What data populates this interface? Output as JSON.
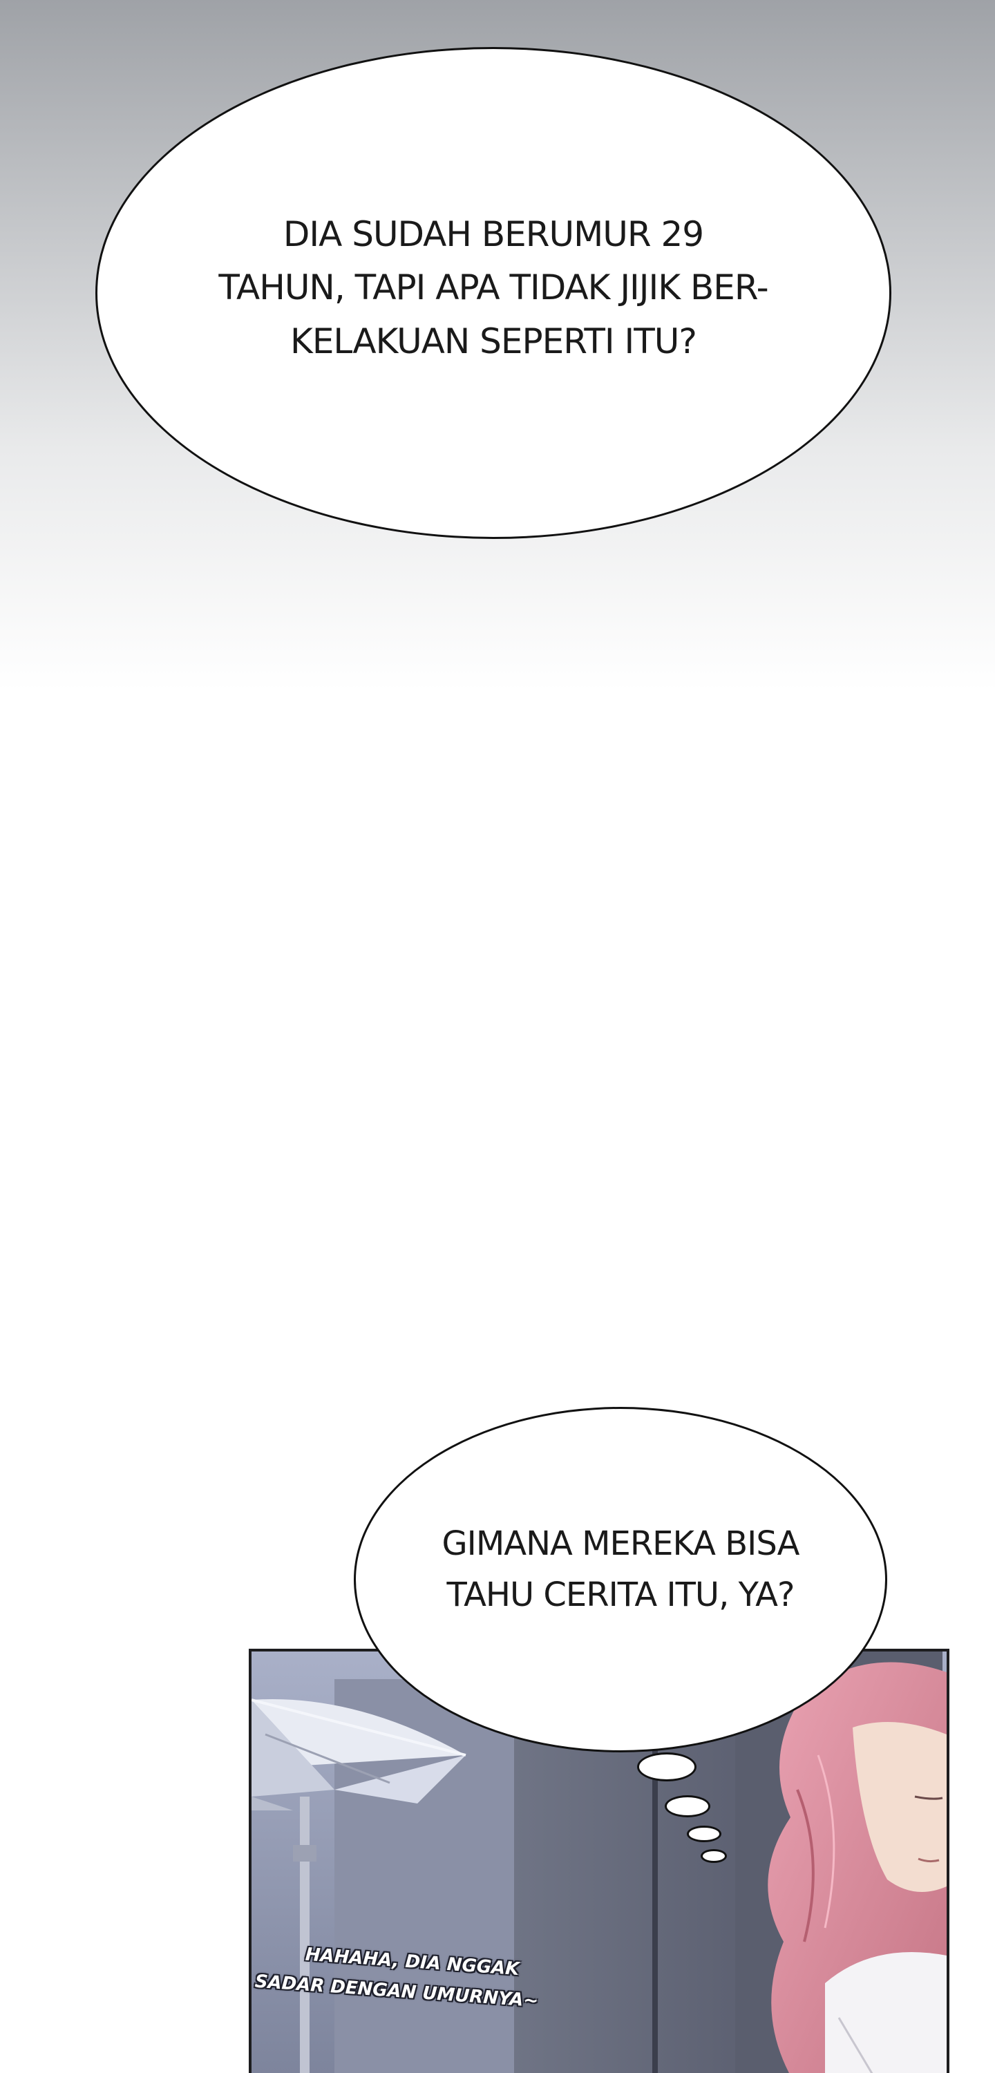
{
  "bubbles": [
    {
      "lines": [
        "DIA SUDAH BERUMUR 29",
        "TAHUN, TAPI APA TIDAK JIJIK BER-",
        "KELAKUAN SEPERTI ITU?"
      ]
    },
    {
      "lines": [
        "GIMANA MEREKA BISA",
        "TAHU CERITA ITU, YA?"
      ]
    }
  ],
  "caption": {
    "lines": [
      "HAHAHA, DIA NGGAK",
      "SADAR DENGAN UMURNYA~"
    ]
  },
  "colors": {
    "bubble_fill": "#ffffff",
    "bubble_outline": "#111111",
    "panel_shadow": "#8e95ac",
    "hair": "#d98fa0"
  },
  "icons": [
    "speech-bubble",
    "thought-bubble-tail",
    "umbrella",
    "character-hair"
  ]
}
